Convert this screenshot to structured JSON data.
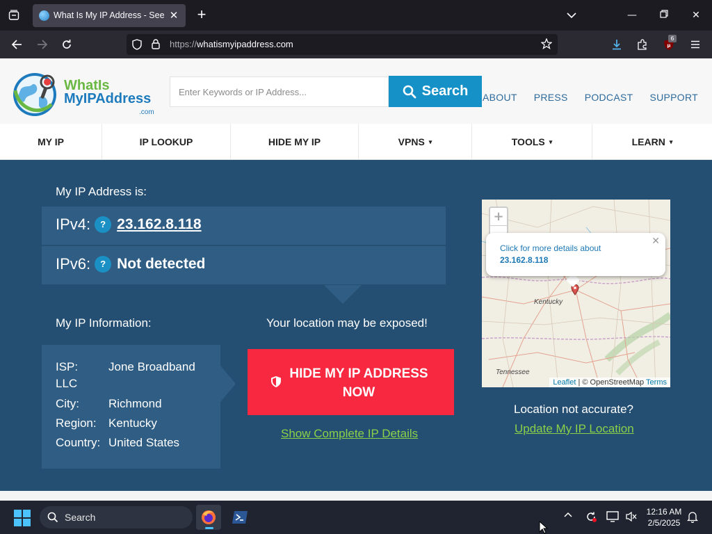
{
  "browser": {
    "tab_title": "What Is My IP Address - See Yo",
    "url_protocol": "https://",
    "url_host": "whatismyipaddress.com",
    "extension_badge": "6"
  },
  "site": {
    "logo_line1": "WhatIs",
    "logo_line2": "MyIPAddress",
    "logo_suffix": ".com",
    "search_placeholder": "Enter Keywords or IP Address...",
    "search_button": "Search",
    "top_links": [
      "ABOUT",
      "PRESS",
      "PODCAST",
      "SUPPORT"
    ],
    "nav": [
      {
        "label": "MY IP",
        "caret": ""
      },
      {
        "label": "IP LOOKUP",
        "caret": ""
      },
      {
        "label": "HIDE MY IP",
        "caret": ""
      },
      {
        "label": "VPNS",
        "caret": "▾"
      },
      {
        "label": "TOOLS",
        "caret": "▾"
      },
      {
        "label": "LEARN",
        "caret": "▾"
      }
    ]
  },
  "hero": {
    "my_ip_heading": "My IP Address is:",
    "ipv4_label": "IPv4:",
    "ipv4_value": "23.162.8.118",
    "ipv6_label": "IPv6:",
    "ipv6_value": "Not detected",
    "help_glyph": "?",
    "info_heading": "My IP Information:",
    "info": [
      {
        "key": "ISP:",
        "value": "Jone Broadband",
        "value2": "LLC"
      },
      {
        "key": "City:",
        "value": "Richmond"
      },
      {
        "key": "Region:",
        "value": "Kentucky"
      },
      {
        "key": "Country:",
        "value": "United States"
      }
    ],
    "exposed_text": "Your location may be exposed!",
    "hide_button_line1": "HIDE MY IP ADDRESS",
    "hide_button_line2": "NOW",
    "details_link": "Show Complete IP Details",
    "map": {
      "popup_line1": "Click for more details about",
      "popup_line2": "23.162.8.118",
      "zoom_in": "+",
      "zoom_out": "−",
      "label_kentucky": "Kentucky",
      "label_tennessee": "Tennessee",
      "attr_leaflet": "Leaflet",
      "attr_sep": " | © OpenStreetMap ",
      "attr_terms": "Terms"
    },
    "accuracy_text": "Location not accurate?",
    "update_link": "Update My IP Location"
  },
  "taskbar": {
    "search_label": "Search",
    "time": "12:16 AM",
    "date": "2/5/2025"
  },
  "colors": {
    "accent": "#1591c8",
    "hero_bg": "#244f72",
    "hide_button": "#f7283f",
    "link_green": "#8ad149"
  }
}
